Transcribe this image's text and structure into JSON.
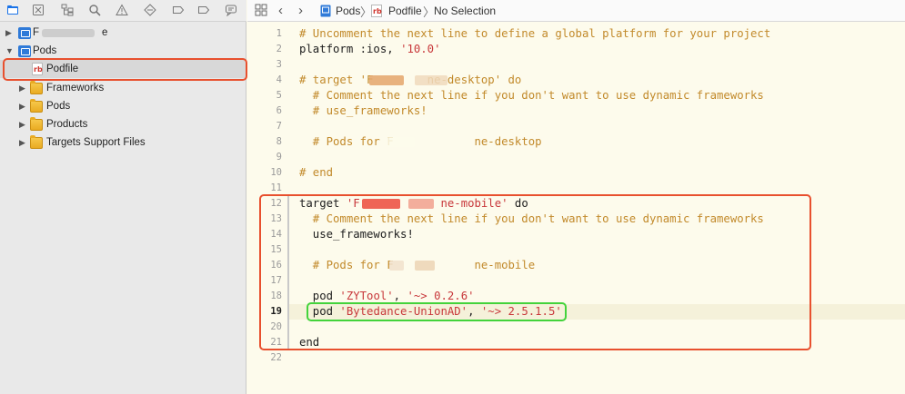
{
  "navigator": {
    "toolbar_icons": [
      "folder-icon",
      "xmark-box-icon",
      "hierarchy-icon",
      "search-icon",
      "warning-icon",
      "diamond-icon",
      "tag-icon",
      "breakpoint-icon",
      "report-icon"
    ],
    "tree": [
      {
        "label": "F",
        "suffix": "e",
        "kind": "project",
        "expanded": false
      },
      {
        "label": "Pods",
        "kind": "project",
        "expanded": true
      },
      {
        "label": "Podfile",
        "kind": "ruby-file",
        "selected": true
      },
      {
        "label": "Frameworks",
        "kind": "folder",
        "expanded": false
      },
      {
        "label": "Pods",
        "kind": "folder",
        "expanded": false
      },
      {
        "label": "Products",
        "kind": "folder",
        "expanded": false
      },
      {
        "label": "Targets Support Files",
        "kind": "folder",
        "expanded": false
      }
    ]
  },
  "jumpbar": {
    "crumbs": [
      "Pods",
      "Podfile",
      "No Selection"
    ]
  },
  "editor": {
    "current_line": 19,
    "lines": [
      {
        "n": "1",
        "parts": [
          {
            "t": "# Uncomment the next line to define a global platform for your project",
            "c": "cmt"
          }
        ]
      },
      {
        "n": "2",
        "parts": [
          {
            "t": "platform :ios, ",
            "c": "kw"
          },
          {
            "t": "'10.0'",
            "c": "str"
          }
        ]
      },
      {
        "n": "3",
        "parts": []
      },
      {
        "n": "4",
        "parts": [
          {
            "t": "# target 'F",
            "c": "cmt"
          },
          {
            "t": "        ",
            "c": "cmt"
          },
          {
            "t": "ne-desktop' do",
            "c": "cmt"
          }
        ]
      },
      {
        "n": "5",
        "parts": [
          {
            "t": "  # Comment the next line if you don't want to use dynamic frameworks",
            "c": "cmt"
          }
        ]
      },
      {
        "n": "6",
        "parts": [
          {
            "t": "  # use_frameworks!",
            "c": "cmt"
          }
        ]
      },
      {
        "n": "7",
        "parts": []
      },
      {
        "n": "8",
        "parts": [
          {
            "t": "  # Pods for F",
            "c": "cmt"
          },
          {
            "t": "            ",
            "c": "cmt"
          },
          {
            "t": "ne-desktop",
            "c": "cmt"
          }
        ]
      },
      {
        "n": "9",
        "parts": []
      },
      {
        "n": "10",
        "parts": [
          {
            "t": "# end",
            "c": "cmt"
          }
        ]
      },
      {
        "n": "11",
        "parts": []
      },
      {
        "n": "12",
        "parts": [
          {
            "t": "target ",
            "c": "kw"
          },
          {
            "t": "'F",
            "c": "str"
          },
          {
            "t": "            ",
            "c": "str"
          },
          {
            "t": "ne-mobile'",
            "c": "str"
          },
          {
            "t": " do",
            "c": "kw"
          }
        ]
      },
      {
        "n": "13",
        "parts": [
          {
            "t": "  # Comment the next line if you don't want to use dynamic frameworks",
            "c": "cmt"
          }
        ]
      },
      {
        "n": "14",
        "parts": [
          {
            "t": "  use_frameworks!",
            "c": "kw"
          }
        ]
      },
      {
        "n": "15",
        "parts": []
      },
      {
        "n": "16",
        "parts": [
          {
            "t": "  # Pods for F",
            "c": "cmt"
          },
          {
            "t": "            ",
            "c": "cmt"
          },
          {
            "t": "ne-mobile",
            "c": "cmt"
          }
        ]
      },
      {
        "n": "17",
        "parts": []
      },
      {
        "n": "18",
        "parts": [
          {
            "t": "  pod ",
            "c": "kw"
          },
          {
            "t": "'ZYTool'",
            "c": "str"
          },
          {
            "t": ", ",
            "c": "kw"
          },
          {
            "t": "'~> 0.2.6'",
            "c": "str"
          }
        ]
      },
      {
        "n": "19",
        "parts": [
          {
            "t": "  pod ",
            "c": "kw"
          },
          {
            "t": "'Bytedance-UnionAD'",
            "c": "str"
          },
          {
            "t": ", ",
            "c": "kw"
          },
          {
            "t": "'~> 2.5.1.5'",
            "c": "str"
          }
        ]
      },
      {
        "n": "20",
        "parts": []
      },
      {
        "n": "21",
        "parts": [
          {
            "t": "end",
            "c": "kw"
          }
        ]
      },
      {
        "n": "22",
        "parts": []
      }
    ]
  },
  "colors": {
    "editor_bg": "#fdfbec",
    "comment": "#c28a2b",
    "string": "#c8383b",
    "highlight_red": "#e8502e",
    "highlight_green": "#43d33b",
    "selection_blue": "#1a73e8"
  }
}
